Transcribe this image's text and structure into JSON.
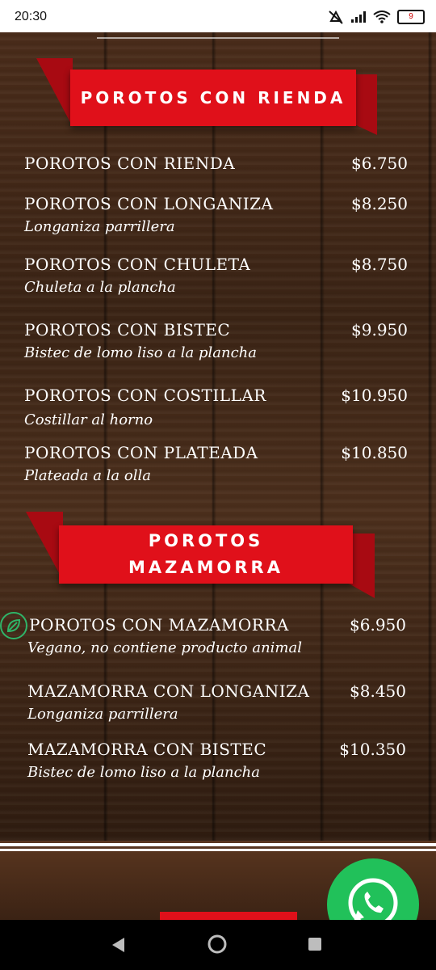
{
  "status": {
    "time": "20:30",
    "battery": "9"
  },
  "sections": [
    {
      "title": "POROTOS CON RIENDA",
      "items": [
        {
          "name": "POROTOS CON RIENDA",
          "price": "$6.750",
          "desc": ""
        },
        {
          "name": "POROTOS CON LONGANIZA",
          "price": "$8.250",
          "desc": "Longaniza parrillera"
        },
        {
          "name": "POROTOS CON CHULETA",
          "price": "$8.750",
          "desc": "Chuleta a la plancha"
        },
        {
          "name": "POROTOS CON BISTEC",
          "price": "$9.950",
          "desc": "Bistec de lomo liso a la plancha"
        },
        {
          "name": "POROTOS CON COSTILLAR",
          "price": "$10.950",
          "desc": "Costillar al horno"
        },
        {
          "name": "POROTOS CON PLATEADA",
          "price": "$10.850",
          "desc": "Plateada a la olla"
        }
      ]
    },
    {
      "title_line1": "POROTOS",
      "title_line2": "MAZAMORRA",
      "items": [
        {
          "name": "POROTOS CON MAZAMORRA",
          "price": "$6.950",
          "desc": "Vegano, no contiene producto animal"
        },
        {
          "name": "MAZAMORRA CON LONGANIZA",
          "price": "$8.450",
          "desc": "Longaniza parrillera"
        },
        {
          "name": "MAZAMORRA CON BISTEC",
          "price": "$10.350",
          "desc": "Bistec de lomo liso a la plancha"
        }
      ]
    }
  ],
  "icons": {
    "vegan": "leaf-icon",
    "whatsapp": "whatsapp-icon",
    "nav_back": "back-triangle-icon",
    "nav_home": "home-circle-icon",
    "nav_recents": "recents-square-icon"
  },
  "colors": {
    "banner_red": "#e0101a",
    "whatsapp_green": "#21c15a",
    "vegan_green": "#2fb468"
  }
}
